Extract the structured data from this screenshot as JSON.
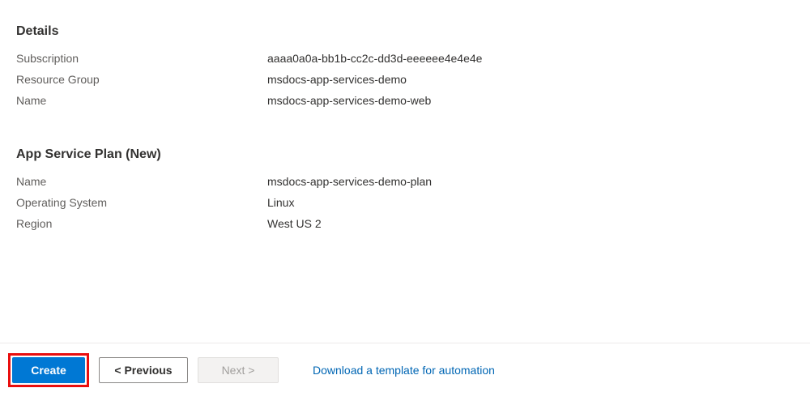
{
  "details": {
    "heading": "Details",
    "rows": {
      "subscription": {
        "label": "Subscription",
        "value": "aaaa0a0a-bb1b-cc2c-dd3d-eeeeee4e4e4e"
      },
      "resourceGroup": {
        "label": "Resource Group",
        "value": "msdocs-app-services-demo"
      },
      "name": {
        "label": "Name",
        "value": "msdocs-app-services-demo-web"
      }
    }
  },
  "appServicePlan": {
    "heading": "App Service Plan (New)",
    "rows": {
      "name": {
        "label": "Name",
        "value": "msdocs-app-services-demo-plan"
      },
      "os": {
        "label": "Operating System",
        "value": "Linux"
      },
      "region": {
        "label": "Region",
        "value": "West US 2"
      }
    }
  },
  "footer": {
    "create": "Create",
    "previous": "< Previous",
    "next": "Next >",
    "downloadLink": "Download a template for automation"
  }
}
